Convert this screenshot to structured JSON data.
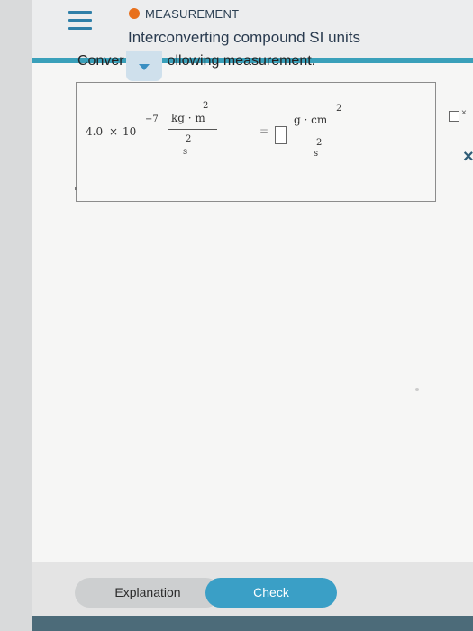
{
  "header": {
    "topic": "MEASUREMENT",
    "title": "Interconverting compound SI units",
    "status_color": "#e8701c"
  },
  "question": {
    "prompt_left": "Conver",
    "prompt_right": "ollowing measurement."
  },
  "expression": {
    "coefficient": "4.0",
    "times": "×",
    "base": "10",
    "exponent": "−7",
    "lhs_numerator": "kg · m",
    "lhs_num_power": "2",
    "lhs_denominator": "s",
    "lhs_den_power": "2",
    "equals": "=",
    "rhs_numerator": "g · cm",
    "rhs_num_power": "2",
    "rhs_denominator": "s",
    "rhs_den_power": "2"
  },
  "side_tools": {
    "clear_symbol": "×",
    "close_symbol": "×"
  },
  "footer": {
    "explanation_label": "Explanation",
    "check_label": "Check"
  },
  "colors": {
    "accent": "#3a9fc6",
    "teal_strip": "#3aa0ba",
    "menu": "#2f7fa8"
  }
}
